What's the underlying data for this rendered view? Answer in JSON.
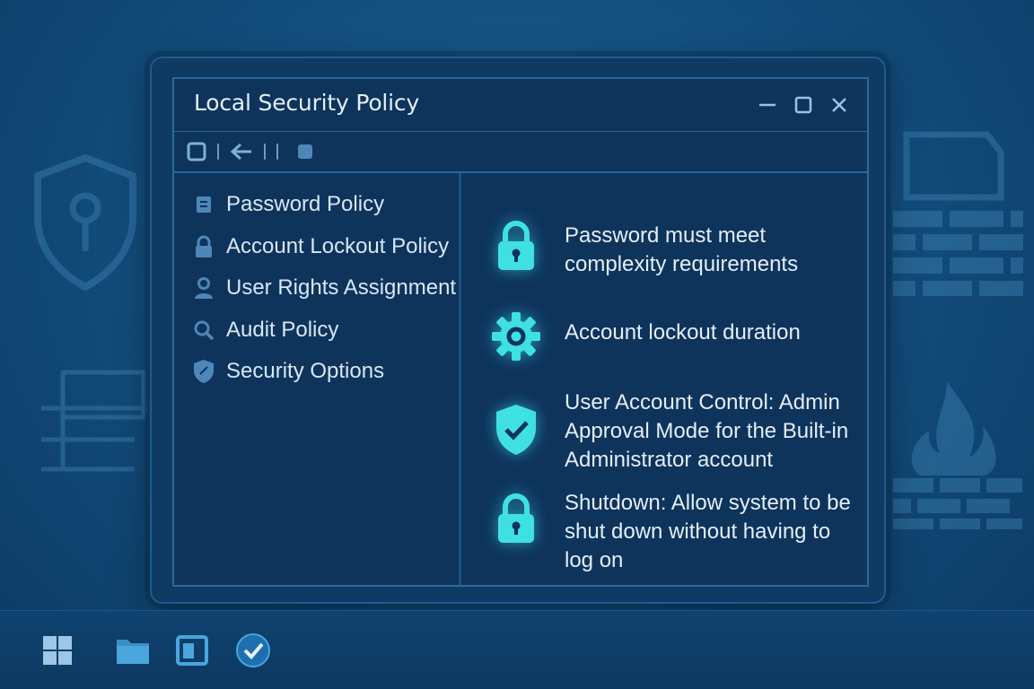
{
  "window": {
    "title": "Local Security Policy",
    "controls": [
      "minimize-icon",
      "maximize-icon",
      "close-icon"
    ]
  },
  "toolbar": {
    "items": [
      "square-icon",
      "separator",
      "back-arrow-icon",
      "separator",
      "separator",
      "stop-icon"
    ]
  },
  "sidebar": {
    "items": [
      {
        "label": "Password Policy",
        "icon": "document-icon"
      },
      {
        "label": "Account Lockout Policy",
        "icon": "lock-icon"
      },
      {
        "label": "User Rights Assignment",
        "icon": "user-icon"
      },
      {
        "label": "Audit Policy",
        "icon": "magnifier-icon"
      },
      {
        "label": "Security Options",
        "icon": "shield-icon"
      }
    ]
  },
  "policies": [
    {
      "text": "Password must meet complexity requirements",
      "icon": "lock-icon"
    },
    {
      "text": "Account lockout duration",
      "icon": "gear-icon"
    },
    {
      "text": "User Account Control: Admin Approval Mode for the Built-in Administrator account",
      "icon": "shield-check-icon"
    },
    {
      "text": "Shutdown: Allow system to be shut down without having to log on",
      "icon": "lock-icon"
    }
  ],
  "taskbar": {
    "items": [
      "windows-start-icon",
      "folder-icon",
      "window-app-icon",
      "checkmark-app-icon"
    ]
  },
  "colors": {
    "accent": "#3fe0e3",
    "background": "#134e7e",
    "window": "#0e345c",
    "text": "#e3eef8"
  }
}
